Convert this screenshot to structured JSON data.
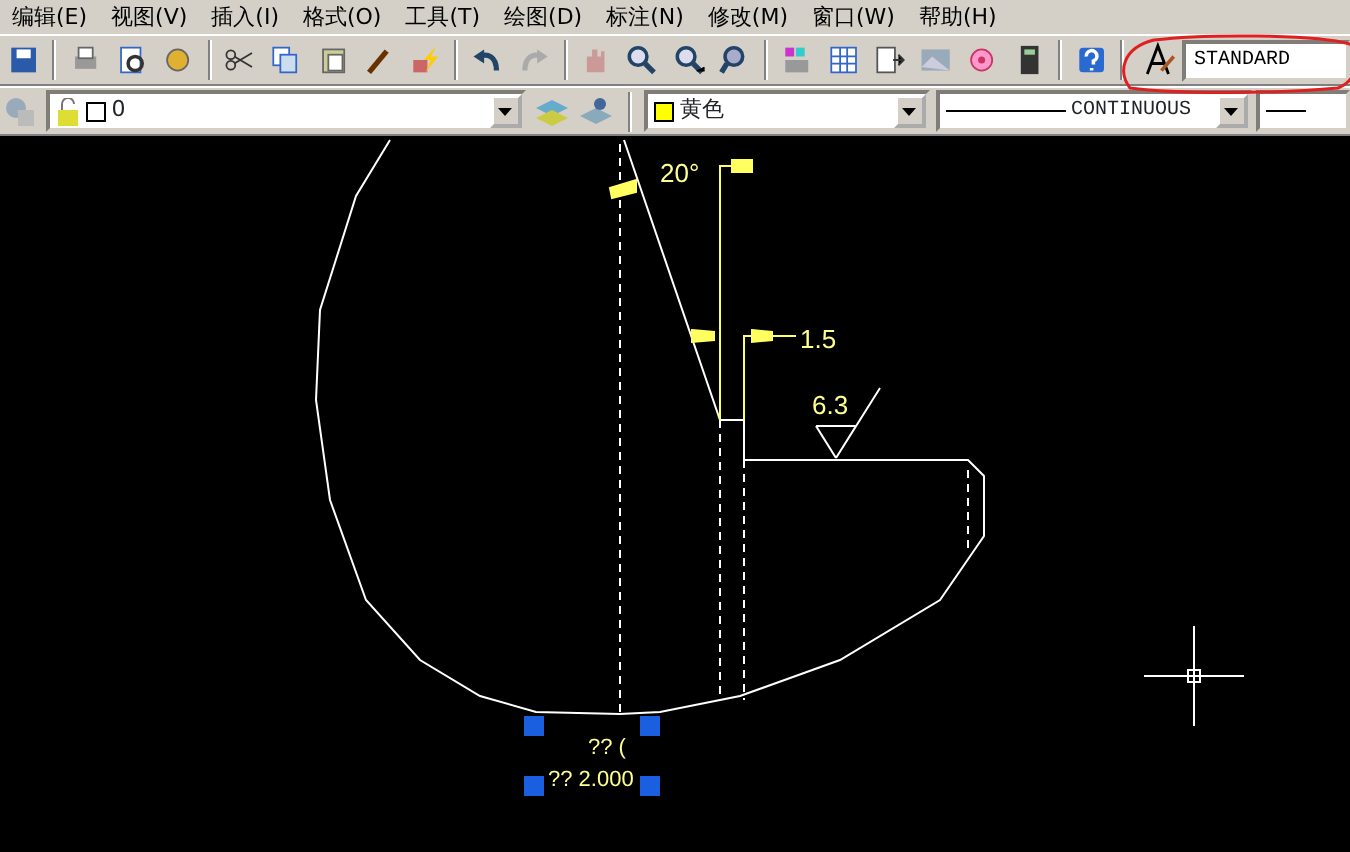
{
  "menu": [
    "编辑(E)",
    "视图(V)",
    "插入(I)",
    "格式(O)",
    "工具(T)",
    "绘图(D)",
    "标注(N)",
    "修改(M)",
    "窗口(W)",
    "帮助(H)"
  ],
  "text_style": {
    "value": "STANDARD"
  },
  "layer": {
    "value": "0"
  },
  "color_control": {
    "value": "黄色",
    "color": "#ffff00"
  },
  "linetype": {
    "value": "CONTINUOUS"
  },
  "drawing_texts": [
    "20°",
    "1.5",
    "6.3",
    "?? (",
    "?? 2.000"
  ]
}
